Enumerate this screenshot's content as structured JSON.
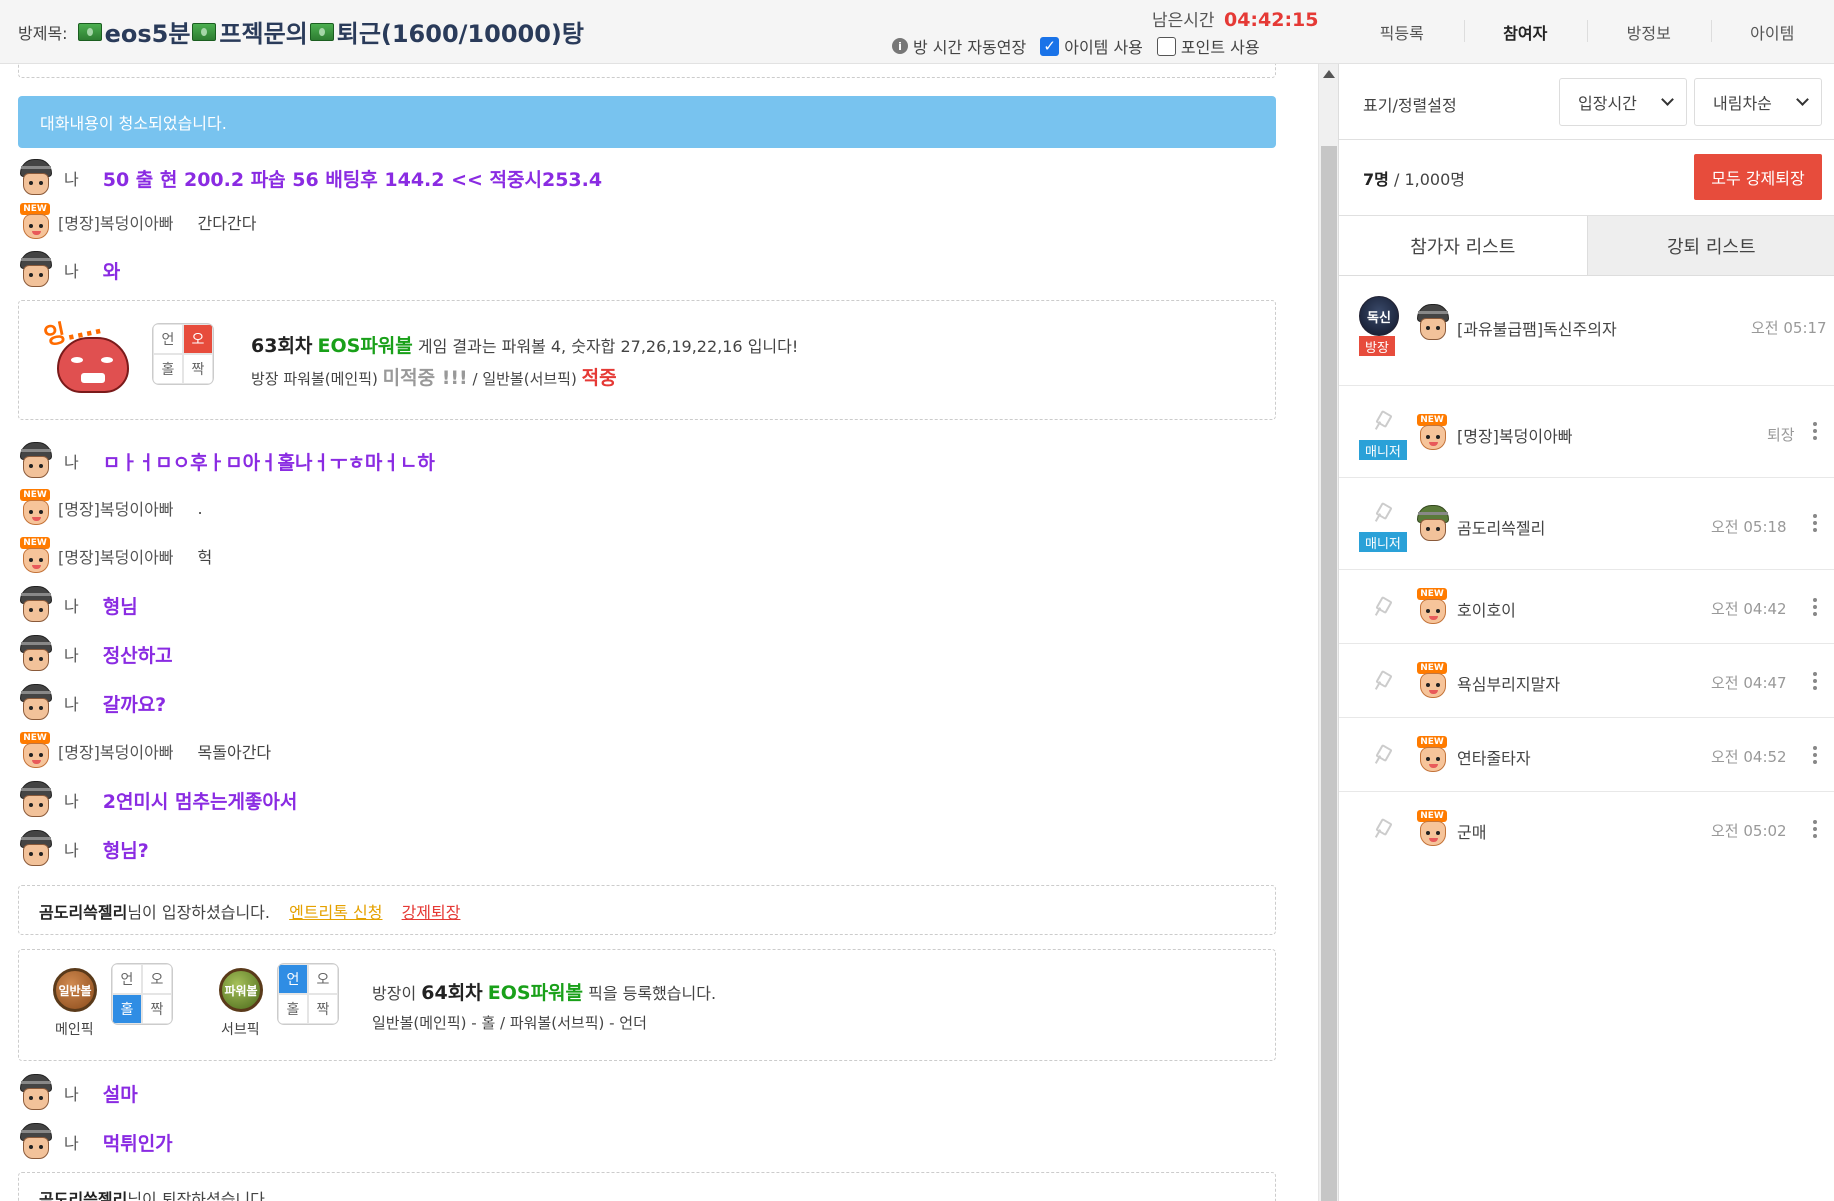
{
  "header": {
    "room_label": "방제목:",
    "room_title_parts": [
      "eos5분",
      "프젝문의",
      "퇴근(1600/10000)탕"
    ],
    "remaining_label": "남은시간",
    "remaining_time": "04:42:15",
    "options": {
      "auto_extend": "방 시간 자동연장",
      "use_item": "아이템 사용",
      "use_item_checked": true,
      "use_point": "포인트 사용",
      "use_point_checked": false
    },
    "nav": [
      "픽등록",
      "참여자",
      "방정보",
      "아이템"
    ],
    "nav_active": "참여자"
  },
  "chat": {
    "notice": "대화내용이 청소되었습니다.",
    "me_label": "나",
    "messages": [
      {
        "avatar": "soldier",
        "who": "나",
        "text": "50 출 현 200.2 파솝 56 배팅후 144.2 << 적중시253.4",
        "style": "big"
      },
      {
        "avatar": "new",
        "who": "[명장]복덩이아빠",
        "text": "간다간다",
        "style": "small"
      },
      {
        "avatar": "soldier",
        "who": "나",
        "text": "와",
        "style": "big"
      },
      {
        "avatar": "soldier",
        "who": "나",
        "text": "ㅁㅏㅓㅁㅇ후ㅏㅁ아ㅓ홀나ㅓㅜㅎ마ㅓㄴ하",
        "style": "big"
      },
      {
        "avatar": "new",
        "who": "[명장]복덩이아빠",
        "text": ".",
        "style": "small"
      },
      {
        "avatar": "new",
        "who": "[명장]복덩이아빠",
        "text": "헉",
        "style": "small"
      },
      {
        "avatar": "soldier",
        "who": "나",
        "text": "형님",
        "style": "big"
      },
      {
        "avatar": "soldier",
        "who": "나",
        "text": "정산하고",
        "style": "big"
      },
      {
        "avatar": "soldier",
        "who": "나",
        "text": "갈까요?",
        "style": "big"
      },
      {
        "avatar": "new",
        "who": "[명장]복덩이아빠",
        "text": "목돌아간다",
        "style": "small"
      },
      {
        "avatar": "soldier",
        "who": "나",
        "text": "2연미시 멈추는게좋아서",
        "style": "big"
      },
      {
        "avatar": "soldier",
        "who": "나",
        "text": "형님?",
        "style": "big"
      },
      {
        "avatar": "soldier",
        "who": "나",
        "text": "설마",
        "style": "big"
      },
      {
        "avatar": "soldier",
        "who": "나",
        "text": "먹튀인가",
        "style": "big"
      }
    ],
    "result_card": {
      "sticker_text": "잉....",
      "grid": [
        "언",
        "오",
        "홀",
        "짝"
      ],
      "round": "63회차",
      "game": "EOS파워볼",
      "line1_rest": "게임 결과는 파워볼 4, 숫자합 27,26,19,22,16 입니다!",
      "line2_prefix": "방장 파워볼(메인픽)",
      "miss": "미적중 !!!",
      "line2_mid": "/ 일반볼(서브픽)",
      "hit": "적중"
    },
    "entry_notice": {
      "name": "곰도리쓱젤리",
      "text": "님이 입장하셨습니다.",
      "link_entry": "엔트리톡 신청",
      "link_kick": "강제퇴장"
    },
    "pick_card": {
      "ball1": "일반볼",
      "ball1_caption": "메인픽",
      "ball2": "파워볼",
      "ball2_caption": "서브픽",
      "grid1": [
        "언",
        "오",
        "홀",
        "짝"
      ],
      "grid2": [
        "언",
        "오",
        "홀",
        "짝"
      ],
      "prefix": "방장이",
      "round": "64회차",
      "game": "EOS파워볼",
      "suffix": "픽을 등록했습니다.",
      "line2": "일반볼(메인픽) - 홀 / 파워볼(서브픽) - 언더"
    },
    "exit_notice": {
      "name": "곰도리쓱젤리",
      "text": "님이 퇴장하셨습니다."
    }
  },
  "side": {
    "sort_label": "표기/정렬설정",
    "sort_by": "입장시간",
    "sort_order": "내림차순",
    "count_current": "7명",
    "count_sep": "/",
    "count_max": "1,000명",
    "kick_all": "모두 강제퇴장",
    "tabs": [
      "참가자 리스트",
      "강퇴 리스트"
    ],
    "participants": [
      {
        "name": "[과유불급팸]독신주의자",
        "time": "오전 05:17",
        "badge": "방장",
        "avatar": "soldier",
        "host_icon": "독신"
      },
      {
        "name": "[명장]복덩이아빠",
        "time": "퇴장",
        "badge": "매니저",
        "avatar": "new"
      },
      {
        "name": "곰도리쓱젤리",
        "time": "오전 05:18",
        "badge": "매니저",
        "avatar": "green"
      },
      {
        "name": "호이호이",
        "time": "오전 04:42",
        "badge": "",
        "avatar": "new"
      },
      {
        "name": "욕심부리지말자",
        "time": "오전 04:47",
        "badge": "",
        "avatar": "new"
      },
      {
        "name": "연타줄타자",
        "time": "오전 04:52",
        "badge": "",
        "avatar": "new"
      },
      {
        "name": "군매",
        "time": "오전 05:02",
        "badge": "",
        "avatar": "new"
      }
    ]
  }
}
